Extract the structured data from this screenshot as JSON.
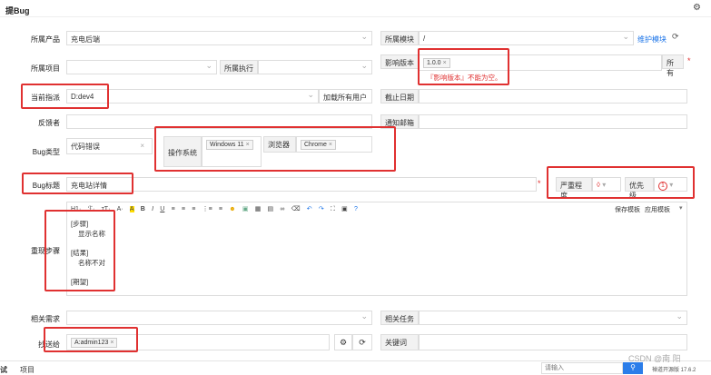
{
  "header": {
    "title": "提Bug",
    "settings_icon": "gear-icon"
  },
  "form": {
    "product": {
      "label": "所属产品",
      "value": "充电后端"
    },
    "module": {
      "label": "所属模块",
      "value": "/",
      "maintain": "维护模块"
    },
    "project": {
      "label": "所属项目",
      "exec_label": "所属执行"
    },
    "version": {
      "label": "影响版本",
      "tag": "1.0.0",
      "error": "『影响版本』不能为空。",
      "all": "所有"
    },
    "build": {
      "label": "当前指派",
      "value": "D:dev4",
      "load_all": "加载所有用户"
    },
    "deadline": {
      "label": "截止日期"
    },
    "feedback": {
      "label": "反馈者",
      "notify": "通知邮箱"
    },
    "type": {
      "label": "Bug类型",
      "value": "代码错误"
    },
    "os": {
      "label": "操作系统",
      "value": "Windows 11"
    },
    "browser": {
      "label": "浏览器",
      "value": "Chrome"
    },
    "title": {
      "label": "Bug标题",
      "value": "充电站详情"
    },
    "severity": {
      "label": "严重程度"
    },
    "priority": {
      "label": "优先级",
      "value": "1"
    },
    "steps": {
      "label": "重现步骤",
      "save_tpl": "保存模板",
      "apply_tpl": "应用模板",
      "lines": [
        "[步骤]",
        "显示名称",
        "[结果]",
        "名称不对",
        "[期望]"
      ]
    },
    "story": {
      "label": "相关需求"
    },
    "task": {
      "label": "相关任务"
    },
    "cc": {
      "label": "抄送给",
      "tag": "A:admin123"
    },
    "keywords": {
      "label": "关键词"
    }
  },
  "footer": {
    "tab1": "试",
    "tab2": "项目",
    "search_placeholder": "请输入",
    "version": "禅道开源版 17.6.2",
    "watermark": "CSDN @南 阳"
  },
  "colors": {
    "red_box": "#e03131",
    "error_text": "#e03131",
    "link": "#1a73e8",
    "search_btn": "#2b7de9"
  }
}
